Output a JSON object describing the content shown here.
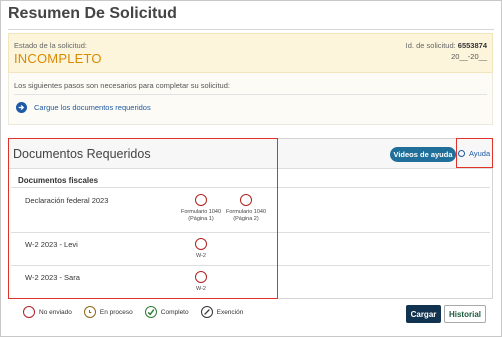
{
  "page": {
    "title": "Resumen De Solicitud"
  },
  "status": {
    "label": "Estado de la solicitud:",
    "value": "INCOMPLETO",
    "id_label": "Id. de solicitud:",
    "id_value": "6553874",
    "date": "20__-20__"
  },
  "steps": {
    "intro": "Los siguientes pasos son necesarios para completar su solicitud:",
    "items": [
      {
        "label": "Cargue los documentos requeridos",
        "icon": "arrow-right-circle-icon"
      }
    ]
  },
  "documents": {
    "title": "Documentos Requeridos",
    "video_button": "Videos de ayuda",
    "help_link": "Ayuda",
    "section_title": "Documentos fiscales",
    "rows": [
      {
        "name": "Declaración federal 2023",
        "forms": [
          "Formulario 1040 (Página 1)",
          "Formulario 1040 (Página 2)"
        ]
      },
      {
        "name": "W-2 2023 - Levi",
        "forms": [
          "W-2"
        ]
      },
      {
        "name": "W-2 2023 - Sara",
        "forms": [
          "W-2"
        ]
      }
    ]
  },
  "legend": [
    {
      "label": "No enviado",
      "icon": "not-sent-icon",
      "color": "#b22222"
    },
    {
      "label": "En proceso",
      "icon": "in-process-icon",
      "color": "#8b6914"
    },
    {
      "label": "Completo",
      "icon": "complete-check-icon",
      "color": "#2e7d32"
    },
    {
      "label": "Exención",
      "icon": "exemption-icon",
      "color": "#333333"
    }
  ],
  "actions": {
    "upload": "Cargar",
    "history": "Historial"
  },
  "colors": {
    "status": "#d98a00",
    "link": "#1f5aa6",
    "button_primary": "#12334f",
    "highlight": "#e0312b"
  }
}
